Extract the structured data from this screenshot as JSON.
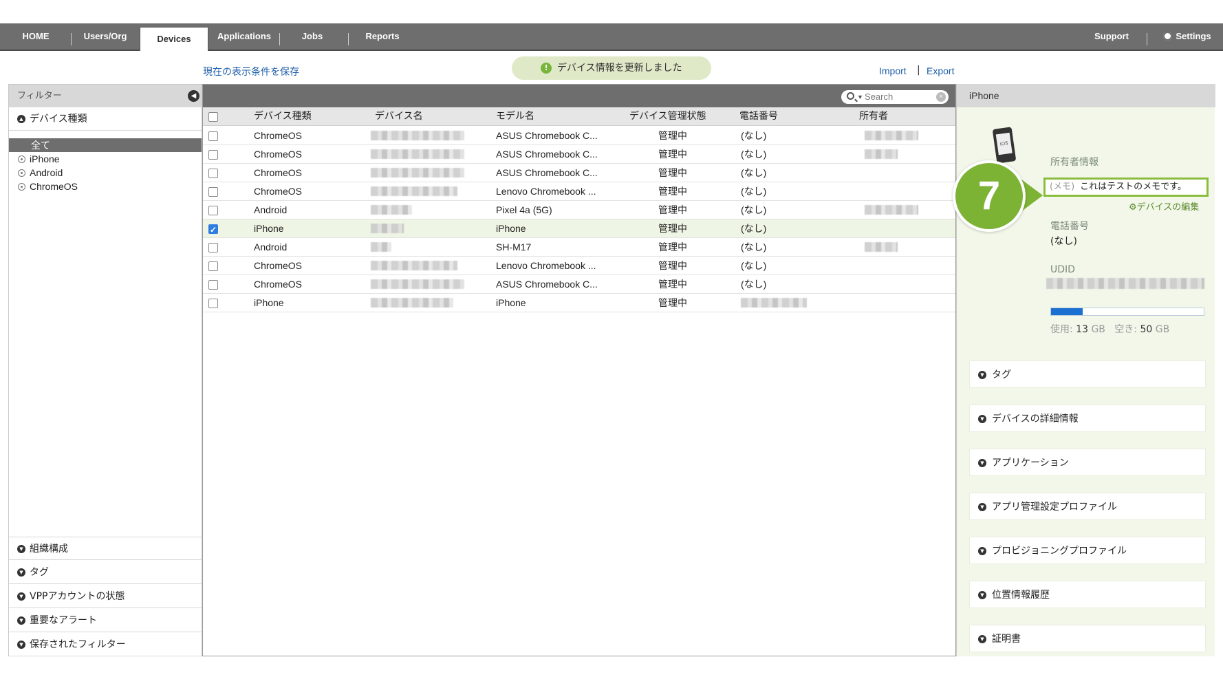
{
  "nav": {
    "items": [
      "HOME",
      "Users/Org",
      "Devices",
      "Applications",
      "Jobs",
      "Reports"
    ],
    "active": "Devices",
    "support": "Support",
    "settings": "Settings"
  },
  "subbar": {
    "save_filter": "現在の表示条件を保存",
    "toast": "デバイス情報を更新しました",
    "import": "Import",
    "separator": "|",
    "export": "Export"
  },
  "filter": {
    "title": "フィルター",
    "device_type_title": "デバイス種類",
    "options": [
      "全て",
      "iPhone",
      "Android",
      "ChromeOS"
    ],
    "selected": "全て",
    "sections": [
      "組織構成",
      "タグ",
      "VPPアカウントの状態",
      "重要なアラート",
      "保存されたフィルター"
    ]
  },
  "table": {
    "search_placeholder": "Search",
    "columns": [
      "デバイス種類",
      "デバイス名",
      "モデル名",
      "デバイス管理状態",
      "電話番号",
      "所有者"
    ],
    "rows": [
      {
        "type": "ChromeOS",
        "model": "ASUS Chromebook C...",
        "status": "管理中",
        "phone": "(なし)",
        "checked": false
      },
      {
        "type": "ChromeOS",
        "model": "ASUS Chromebook C...",
        "status": "管理中",
        "phone": "(なし)",
        "checked": false
      },
      {
        "type": "ChromeOS",
        "model": "ASUS Chromebook C...",
        "status": "管理中",
        "phone": "(なし)",
        "checked": false
      },
      {
        "type": "ChromeOS",
        "model": "Lenovo Chromebook ...",
        "status": "管理中",
        "phone": "(なし)",
        "checked": false
      },
      {
        "type": "Android",
        "model": "Pixel 4a (5G)",
        "status": "管理中",
        "phone": "(なし)",
        "checked": false
      },
      {
        "type": "iPhone",
        "model": "iPhone",
        "status": "管理中",
        "phone": "(なし)",
        "checked": true
      },
      {
        "type": "Android",
        "model": "SH-M17",
        "status": "管理中",
        "phone": "(なし)",
        "checked": false
      },
      {
        "type": "ChromeOS",
        "model": "Lenovo Chromebook ...",
        "status": "管理中",
        "phone": "(なし)",
        "checked": false
      },
      {
        "type": "ChromeOS",
        "model": "ASUS Chromebook C...",
        "status": "管理中",
        "phone": "(なし)",
        "checked": false
      },
      {
        "type": "iPhone",
        "model": "iPhone",
        "status": "管理中",
        "phone": "",
        "checked": false
      }
    ]
  },
  "detail": {
    "title": "iPhone",
    "device_badge": "iOS",
    "owner_label": "所有者情報",
    "memo_key": "(メモ)",
    "memo_text": "これはテストのメモです。",
    "edit_link": "デバイスの編集",
    "phone_label": "電話番号",
    "phone_value": "(なし)",
    "udid_label": "UDID",
    "storage": {
      "used_label": "使用:",
      "used_value": "13",
      "used_unit": "GB",
      "free_label": "空き:",
      "free_value": "50",
      "free_unit": "GB",
      "used_fraction": 0.206
    },
    "sections": [
      "タグ",
      "デバイスの詳細情報",
      "アプリケーション",
      "アプリ管理設定プロファイル",
      "プロビジョニングプロファイル",
      "位置情報履歴",
      "証明書"
    ]
  },
  "step_marker": "7",
  "colors": {
    "nav_bg": "#6e6e6e",
    "accent_green": "#7db335",
    "link_blue": "#1f5fa8",
    "storage_fill": "#1b6fd0"
  }
}
